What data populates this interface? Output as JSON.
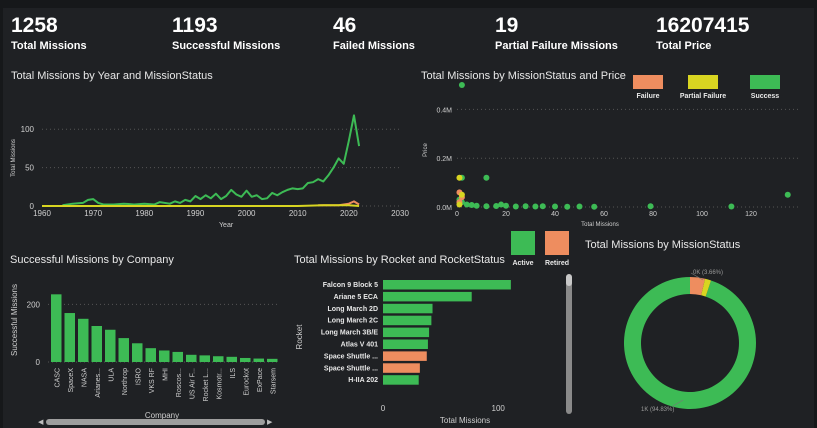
{
  "kpis": [
    {
      "value": "1258",
      "label": "Total Missions"
    },
    {
      "value": "1193",
      "label": "Successful Missions"
    },
    {
      "value": "46",
      "label": "Failed Missions"
    },
    {
      "value": "19",
      "label": "Partial Failure Missions"
    },
    {
      "value": "16207415",
      "label": "Total Price"
    }
  ],
  "colors": {
    "success": "#3dbb55",
    "failure": "#ee8d5f",
    "partial": "#d8d521",
    "active": "#3dbb55",
    "retired": "#ee8d5f",
    "background": "#1f2124"
  },
  "titles": {
    "line": "Total Missions by Year and MissionStatus",
    "scatter": "Total Missions by MissionStatus and Price",
    "company": "Successful Missions by Company",
    "rocket": "Total Missions by Rocket and RocketStatus",
    "donut": "Total Missions by MissionStatus"
  },
  "chart_data": [
    {
      "type": "line",
      "title": "Total Missions by Year and MissionStatus",
      "xlabel": "Year",
      "ylabel": "Total Missions",
      "xlim": [
        1960,
        2030
      ],
      "ylim": [
        0,
        125
      ],
      "xticks": [
        "1960",
        "1970",
        "1980",
        "1990",
        "2000",
        "2010",
        "2020",
        "2030"
      ],
      "yticks": [
        "0",
        "50",
        "100"
      ],
      "series": [
        {
          "name": "Success",
          "color": "#3dbb55",
          "x": [
            1964,
            1966,
            1968,
            1969,
            1970,
            1971,
            1972,
            1974,
            1976,
            1978,
            1980,
            1982,
            1983,
            1985,
            1986,
            1987,
            1988,
            1989,
            1990,
            1991,
            1992,
            1993,
            1994,
            1995,
            1996,
            1997,
            1998,
            1999,
            2000,
            2001,
            2002,
            2003,
            2004,
            2005,
            2006,
            2007,
            2008,
            2009,
            2010,
            2011,
            2012,
            2013,
            2014,
            2015,
            2016,
            2017,
            2018,
            2019,
            2020,
            2021,
            2022
          ],
          "y": [
            1,
            3,
            4,
            8,
            9,
            4,
            2,
            2,
            3,
            2,
            3,
            2,
            5,
            3,
            6,
            4,
            8,
            6,
            13,
            9,
            14,
            10,
            16,
            9,
            13,
            21,
            15,
            12,
            20,
            12,
            14,
            9,
            10,
            17,
            14,
            18,
            21,
            23,
            22,
            23,
            30,
            31,
            35,
            32,
            40,
            50,
            62,
            55,
            85,
            118,
            78
          ]
        },
        {
          "name": "Failure",
          "color": "#ee8d5f",
          "x": [
            2014,
            2016,
            2018,
            2019,
            2020,
            2021,
            2022
          ],
          "y": [
            1,
            1,
            1,
            2,
            3,
            6,
            2
          ]
        },
        {
          "name": "Partial Failure",
          "color": "#d8d521",
          "x": [
            1960,
            1970,
            1980,
            1990,
            2000,
            2010,
            2015,
            2020,
            2022
          ],
          "y": [
            0,
            0,
            0,
            0,
            0,
            0,
            1,
            1,
            0
          ]
        }
      ]
    },
    {
      "type": "scatter",
      "title": "Total Missions by MissionStatus and Price",
      "xlabel": "Total Missions",
      "ylabel": "Price",
      "xlim": [
        0,
        140
      ],
      "ylim": [
        0,
        0.5
      ],
      "xticks": [
        "0",
        "20",
        "40",
        "60",
        "80",
        "100",
        "120"
      ],
      "yticks": [
        "0.0M",
        "0.2M",
        "0.4M"
      ],
      "legend": [
        "Failure",
        "Partial Failure",
        "Success"
      ],
      "series": [
        {
          "name": "Success",
          "color": "#3dbb55",
          "points": [
            [
              2,
              0.5
            ],
            [
              2,
              0.12
            ],
            [
              1,
              0.03
            ],
            [
              2,
              0.02
            ],
            [
              4,
              0.01
            ],
            [
              8,
              0.005
            ],
            [
              12,
              0.003
            ],
            [
              16,
              0.004
            ],
            [
              20,
              0.005
            ],
            [
              24,
              0.002
            ],
            [
              28,
              0.003
            ],
            [
              32,
              0.002
            ],
            [
              35,
              0.003
            ],
            [
              40,
              0.002
            ],
            [
              45,
              0.001
            ],
            [
              50,
              0.002
            ],
            [
              56,
              0.001
            ],
            [
              79,
              0.003
            ],
            [
              112,
              0.002
            ],
            [
              135,
              0.05
            ],
            [
              12,
              0.12
            ],
            [
              6,
              0.008
            ],
            [
              18,
              0.01
            ]
          ]
        },
        {
          "name": "Failure",
          "color": "#ee8d5f",
          "points": [
            [
              1,
              0.06
            ],
            [
              2,
              0.04
            ],
            [
              1,
              0.02
            ]
          ]
        },
        {
          "name": "Partial Failure",
          "color": "#d8d521",
          "points": [
            [
              1,
              0.12
            ],
            [
              2,
              0.05
            ],
            [
              1,
              0.01
            ]
          ]
        }
      ]
    },
    {
      "type": "bar",
      "title": "Successful Missions by Company",
      "xlabel": "Company",
      "ylabel": "Successful Missions",
      "ylim": [
        0,
        250
      ],
      "yticks": [
        "0",
        "200"
      ],
      "categories": [
        "CASC",
        "SpaceX",
        "NASA",
        "Arianes...",
        "ULA",
        "Northrop",
        "ISRO",
        "VKS RF",
        "MHI",
        "Roscos...",
        "US Air F...",
        "Rocket L...",
        "Kosmotr...",
        "ILS",
        "Eurockot",
        "ExPace",
        "Starsem"
      ],
      "values": [
        235,
        170,
        150,
        125,
        112,
        83,
        65,
        48,
        40,
        35,
        25,
        23,
        20,
        18,
        14,
        12,
        11
      ]
    },
    {
      "type": "bar",
      "orientation": "horizontal",
      "title": "Total Missions by Rocket and RocketStatus",
      "xlabel": "Total Missions",
      "ylabel": "Rocket",
      "xlim": [
        0,
        125
      ],
      "xticks": [
        "0",
        "100"
      ],
      "legend": [
        "Active",
        "Retired"
      ],
      "categories": [
        "Falcon 9 Block 5",
        "Ariane 5 ECA",
        "Long March 2D",
        "Long March 2C",
        "Long March 3B/E",
        "Atlas V 401",
        "Space Shuttle ...",
        "Space Shuttle ...",
        "H-IIA 202"
      ],
      "values": [
        111,
        77,
        43,
        42,
        40,
        39,
        38,
        32,
        31
      ],
      "status": [
        "Active",
        "Active",
        "Active",
        "Active",
        "Active",
        "Active",
        "Retired",
        "Retired",
        "Active"
      ]
    },
    {
      "type": "pie",
      "title": "Total Missions by MissionStatus",
      "slices": [
        {
          "label": "Success",
          "value": 94.83,
          "color": "#3dbb55",
          "annotation": "1K (94.83%)"
        },
        {
          "label": "Failure",
          "value": 3.66,
          "color": "#ee8d5f",
          "annotation": "0K (3.66%)"
        },
        {
          "label": "Partial Failure",
          "value": 1.51,
          "color": "#d8d521",
          "annotation": ""
        }
      ]
    }
  ]
}
